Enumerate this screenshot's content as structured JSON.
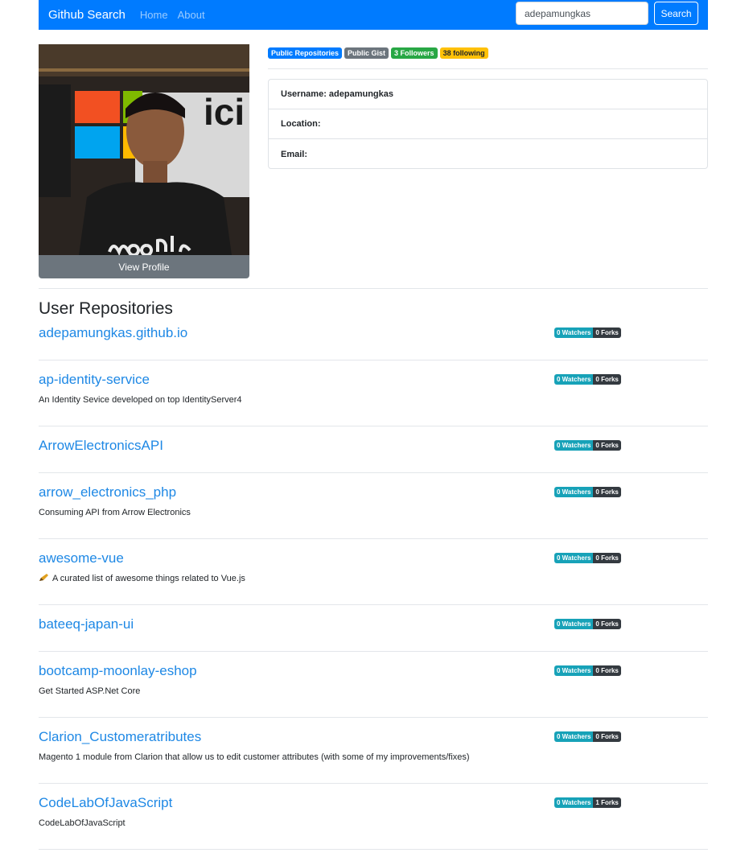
{
  "navbar": {
    "brand": "Github Search",
    "links": [
      "Home",
      "About"
    ],
    "search_value": "adepamungkas",
    "search_button": "Search"
  },
  "profile": {
    "view_profile": "View Profile",
    "badges": {
      "repos": "Public Repositories",
      "gist": "Public Gist",
      "followers": "3 Followers",
      "following": "38 following"
    },
    "username": "Username: adepamungkas",
    "location": "Location:",
    "email": "Email:"
  },
  "section_title": "User Repositories",
  "repos": [
    {
      "name": "adepamungkas.github.io",
      "desc": "",
      "watchers": "0 Watchers",
      "forks": "0 Forks"
    },
    {
      "name": "ap-identity-service",
      "desc": "An Identity Sevice developed on top IdentityServer4",
      "watchers": "0 Watchers",
      "forks": "0 Forks"
    },
    {
      "name": "ArrowElectronicsAPI",
      "desc": "",
      "watchers": "0 Watchers",
      "forks": "0 Forks"
    },
    {
      "name": "arrow_electronics_php",
      "desc": "Consuming API from Arrow Electronics",
      "watchers": "0 Watchers",
      "forks": "0 Forks"
    },
    {
      "name": "awesome-vue",
      "desc": "A curated list of awesome things related to Vue.js",
      "watchers": "0 Watchers",
      "forks": "0 Forks"
    },
    {
      "name": "bateeq-japan-ui",
      "desc": "",
      "watchers": "0 Watchers",
      "forks": "0 Forks"
    },
    {
      "name": "bootcamp-moonlay-eshop",
      "desc": "Get Started ASP.Net Core",
      "watchers": "0 Watchers",
      "forks": "0 Forks"
    },
    {
      "name": "Clarion_Customeratributes",
      "desc": "Magento 1 module from Clarion that allow us to edit customer attributes (with some of my improvements/fixes)",
      "watchers": "0 Watchers",
      "forks": "0 Forks"
    },
    {
      "name": "CodeLabOfJavaScript",
      "desc": "CodeLabOfJavaScript",
      "watchers": "0 Watchers",
      "forks": "1 Forks"
    }
  ]
}
